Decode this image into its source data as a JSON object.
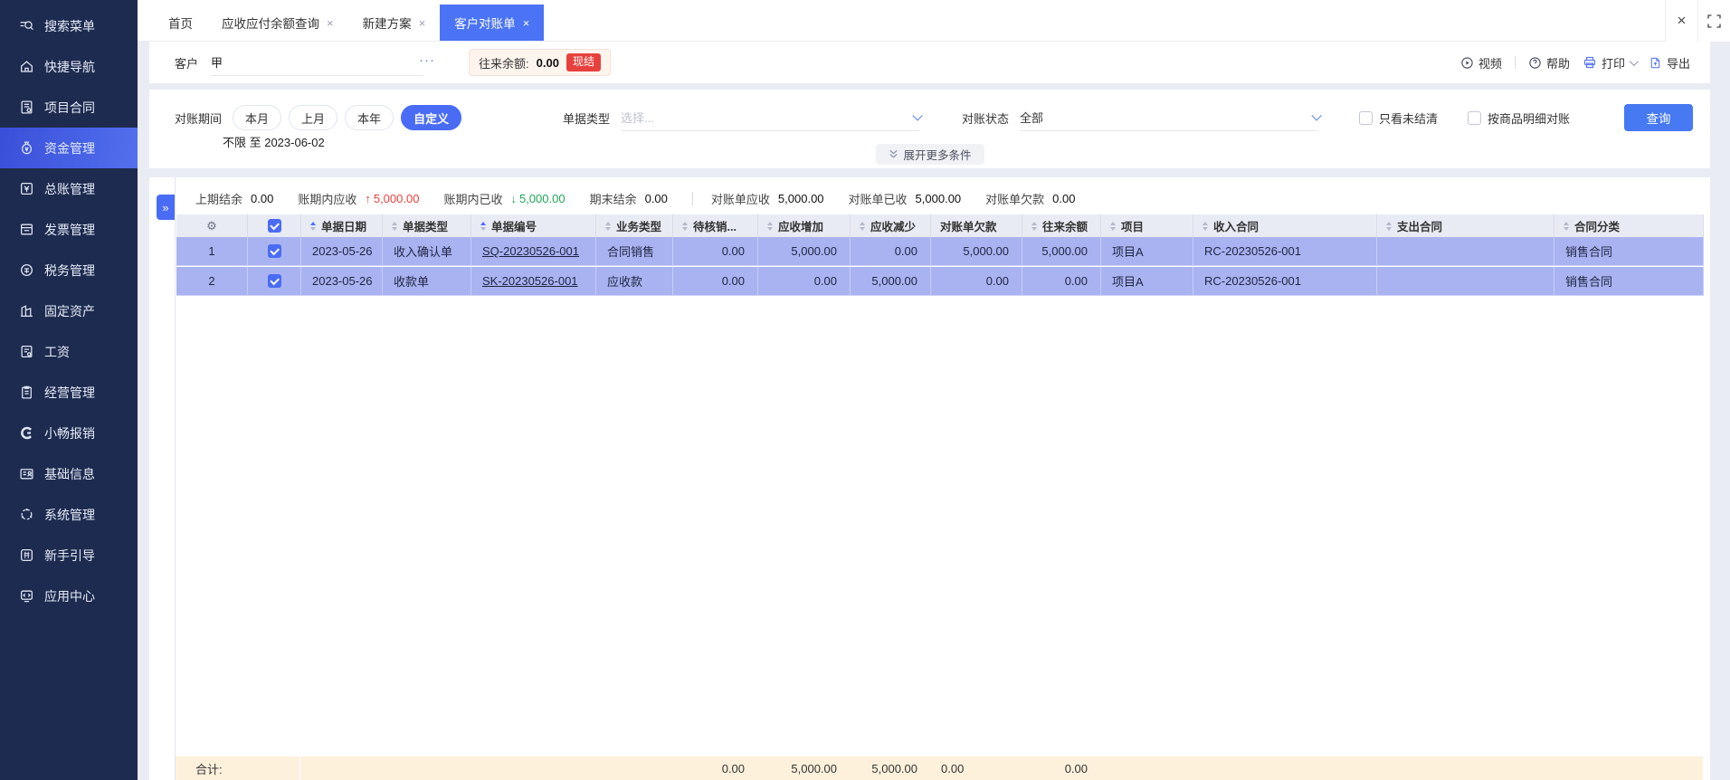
{
  "colors": {
    "accent": "#4a6cf5",
    "active_tab": "#4a73f5",
    "sidebar_bg": "#1e2b50",
    "row_highlight": "#a9b3f1",
    "footer_bg": "#fdf1dc",
    "red": "#e8413d",
    "green": "#1ea657",
    "badge_red": "#e8413d"
  },
  "icons": {
    "gear": "⚙",
    "more": "···",
    "collapse": "»",
    "close": "×",
    "arrow_up": "↑",
    "arrow_down": "↓"
  },
  "tabbar": {
    "close_symbol": "×",
    "tabs": [
      {
        "label": "首页",
        "closable": false,
        "active": false
      },
      {
        "label": "应收应付余额查询",
        "closable": true,
        "active": false
      },
      {
        "label": "新建方案",
        "closable": true,
        "active": false
      },
      {
        "label": "客户对账单",
        "closable": true,
        "active": true
      }
    ]
  },
  "sidebar": {
    "items": [
      {
        "label": "搜索菜单",
        "icon": "search-menu"
      },
      {
        "label": "快捷导航",
        "icon": "home"
      },
      {
        "label": "项目合同",
        "icon": "project-contract"
      },
      {
        "label": "资金管理",
        "icon": "money-bag",
        "active": true
      },
      {
        "label": "总账管理",
        "icon": "ledger"
      },
      {
        "label": "发票管理",
        "icon": "invoice"
      },
      {
        "label": "税务管理",
        "icon": "tax"
      },
      {
        "label": "固定资产",
        "icon": "buildings"
      },
      {
        "label": "工资",
        "icon": "payroll"
      },
      {
        "label": "经营管理",
        "icon": "clipboard"
      },
      {
        "label": "小畅报销",
        "icon": "c-logo"
      },
      {
        "label": "基础信息",
        "icon": "id-card"
      },
      {
        "label": "系统管理",
        "icon": "system-nodes"
      },
      {
        "label": "新手引导",
        "icon": "guide"
      },
      {
        "label": "应用中心",
        "icon": "app-center"
      }
    ]
  },
  "header": {
    "customer_label": "客户",
    "customer_value": "甲",
    "balance_label": "往来余额:",
    "balance_value": "0.00",
    "settle_badge": "现结",
    "toolbar": {
      "video": "视频",
      "help": "帮助",
      "print": "打印",
      "export": "导出"
    }
  },
  "filters": {
    "period_label": "对账期间",
    "period_options": [
      "本月",
      "上月",
      "本年",
      "自定义"
    ],
    "period_active": "自定义",
    "period_range": "不限 至 2023-06-02",
    "doc_type_label": "单据类型",
    "doc_type_placeholder": "选择...",
    "status_label": "对账状态",
    "status_value": "全部",
    "checkbox_unsettled": "只看未结清",
    "checkbox_by_product": "按商品明细对账",
    "query_button": "查询",
    "expand_more": "展开更多条件"
  },
  "summary": {
    "items": [
      {
        "label": "上期结余",
        "value": "0.00",
        "trend": "none"
      },
      {
        "label": "账期内应收",
        "value": "5,000.00",
        "trend": "up"
      },
      {
        "label": "账期内已收",
        "value": "5,000.00",
        "trend": "down"
      },
      {
        "label": "期末结余",
        "value": "0.00",
        "trend": "none"
      },
      {
        "label": "对账单应收",
        "value": "5,000.00",
        "trend": "none"
      },
      {
        "label": "对账单已收",
        "value": "5,000.00",
        "trend": "none"
      },
      {
        "label": "对账单欠款",
        "value": "0.00",
        "trend": "none"
      }
    ]
  },
  "table": {
    "columns": [
      {
        "label": "",
        "type": "gear"
      },
      {
        "label": "",
        "type": "checkbox"
      },
      {
        "label": "单据日期",
        "sort": "asc"
      },
      {
        "label": "单据类型",
        "sort": "both"
      },
      {
        "label": "单据编号",
        "sort": "asc"
      },
      {
        "label": "业务类型",
        "sort": "both"
      },
      {
        "label": "待核销...",
        "sort": "both"
      },
      {
        "label": "应收增加",
        "sort": "both"
      },
      {
        "label": "应收减少",
        "sort": "both"
      },
      {
        "label": "对账单欠款",
        "sort": "none"
      },
      {
        "label": "往来余额",
        "sort": "both"
      },
      {
        "label": "项目",
        "sort": "both"
      },
      {
        "label": "收入合同",
        "sort": "both"
      },
      {
        "label": "支出合同",
        "sort": "both"
      },
      {
        "label": "合同分类",
        "sort": "both"
      }
    ],
    "rows": [
      {
        "index": "1",
        "checked": true,
        "date": "2023-05-26",
        "doc_type": "收入确认单",
        "doc_no": "SQ-20230526-001",
        "biz_type": "合同销售",
        "pending": "0.00",
        "ar_increase": "5,000.00",
        "ar_decrease": "0.00",
        "statement_due": "5,000.00",
        "balance": "5,000.00",
        "project": "项目A",
        "income_contract": "RC-20230526-001",
        "expense_contract": "",
        "contract_category": "销售合同"
      },
      {
        "index": "2",
        "checked": true,
        "date": "2023-05-26",
        "doc_type": "收款单",
        "doc_no": "SK-20230526-001",
        "biz_type": "应收款",
        "pending": "0.00",
        "ar_increase": "0.00",
        "ar_decrease": "5,000.00",
        "statement_due": "0.00",
        "balance": "0.00",
        "project": "项目A",
        "income_contract": "RC-20230526-001",
        "expense_contract": "",
        "contract_category": "销售合同"
      }
    ],
    "footer": {
      "label": "合计:",
      "pending": "0.00",
      "ar_increase": "5,000.00",
      "ar_decrease": "5,000.00",
      "statement_due": "0.00",
      "balance": "0.00"
    }
  }
}
